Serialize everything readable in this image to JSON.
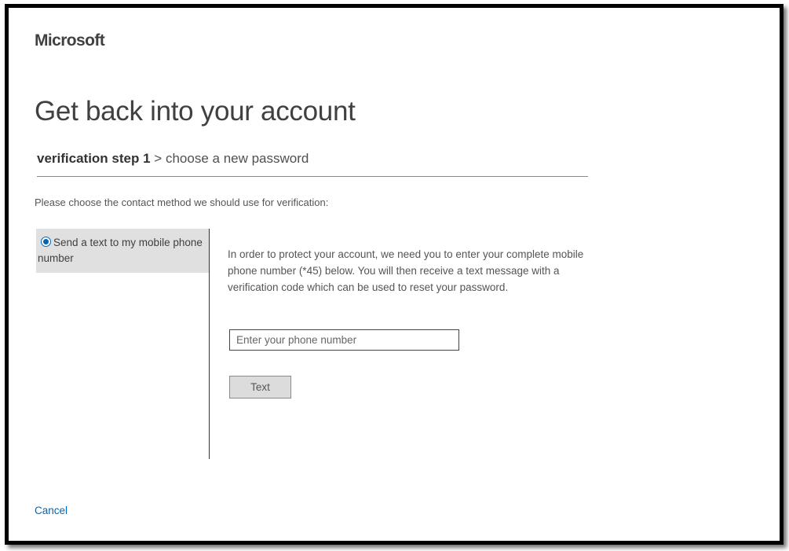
{
  "header": {
    "logo_text": "Microsoft"
  },
  "page": {
    "title": "Get back into your account"
  },
  "breadcrumb": {
    "current_step": "verification step 1",
    "separator": ">",
    "next_step": "choose a new password"
  },
  "verification": {
    "prompt": "Please choose the contact method we should use for verification:",
    "methods": [
      {
        "label": "Send a text to my mobile phone number",
        "selected": true
      }
    ],
    "instructions": "In order to protect your account, we need you to enter your complete mobile phone number (*45) below. You will then receive a text message with a verification code which can be used to reset your password.",
    "phone_input": {
      "placeholder": "Enter your phone number",
      "value": ""
    },
    "submit_label": "Text"
  },
  "footer": {
    "cancel_label": "Cancel"
  },
  "colors": {
    "accent": "#0067b8",
    "text": "#404040",
    "tile_background": "#e0e0e0",
    "button_background": "#dcdcdc"
  }
}
